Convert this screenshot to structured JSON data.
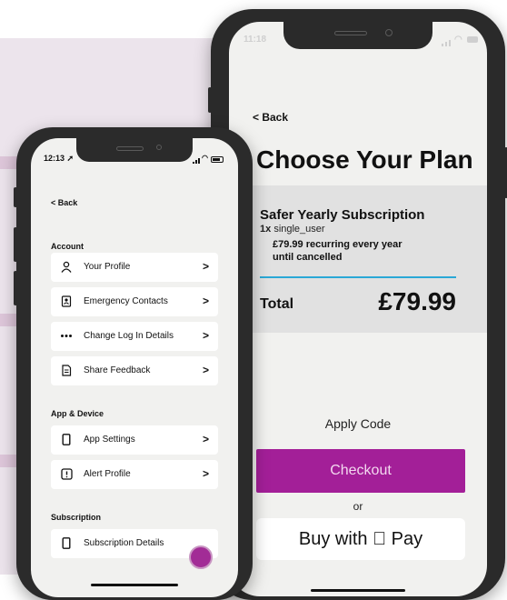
{
  "right_screen": {
    "status_time": "11:18",
    "back_label": "< Back",
    "title": "Choose Your Plan",
    "subscription": {
      "name": "Safer Yearly Subscription",
      "quantity": "1x",
      "plan_code": "single_user",
      "price_line1": "£79.99 recurring every year",
      "price_line2": "until cancelled"
    },
    "total_label": "Total",
    "total_value": "£79.99",
    "apply_code_label": "Apply Code",
    "checkout_label": "Checkout",
    "or_label": "or",
    "apple_pay_label": "Buy with  Pay"
  },
  "left_screen": {
    "status_time": "12:13",
    "back_label": "< Back",
    "sections": {
      "account": "Account",
      "app_device": "App & Device",
      "subscription": "Subscription"
    },
    "items": [
      {
        "label": "Your Profile",
        "icon": "person-icon"
      },
      {
        "label": "Emergency Contacts",
        "icon": "contacts-book-icon"
      },
      {
        "label": "Change Log In Details",
        "icon": "password-dots-icon"
      },
      {
        "label": "Share Feedback",
        "icon": "document-icon"
      },
      {
        "label": "App Settings",
        "icon": "phone-icon"
      },
      {
        "label": "Alert Profile",
        "icon": "alert-icon"
      },
      {
        "label": "Subscription Details",
        "icon": "phone-icon"
      }
    ],
    "chevron": ">"
  },
  "colors": {
    "accent": "#a31f98",
    "divider": "#2aa8d6",
    "background_panel": "#ece4ec"
  }
}
